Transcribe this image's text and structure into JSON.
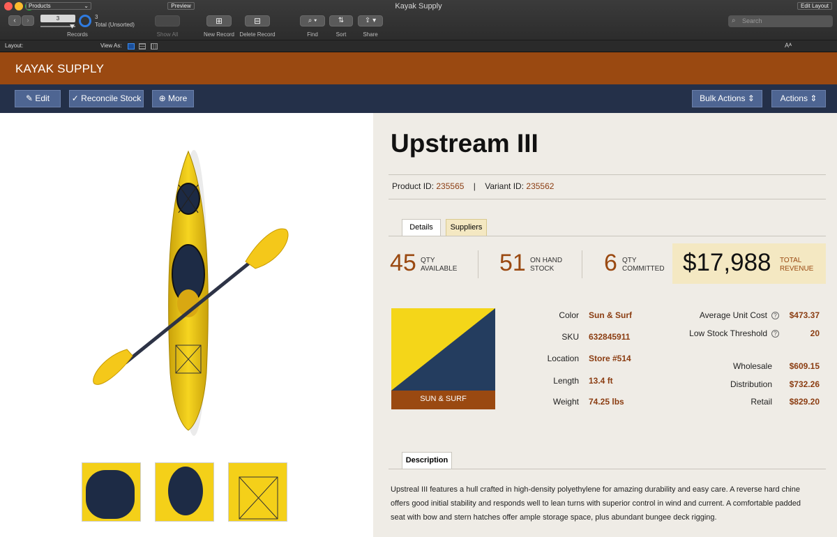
{
  "window": {
    "title": "Kayak Supply"
  },
  "toolbar": {
    "record_current": "3",
    "records_label": "Records",
    "total_count": "3",
    "total_status": "Total (Unsorted)",
    "show_all": "Show All",
    "new_record": "New Record",
    "delete_record": "Delete Record",
    "find": "Find",
    "sort": "Sort",
    "share": "Share",
    "search_placeholder": "Search"
  },
  "layout_bar": {
    "layout_label": "Layout:",
    "layout_value": "Products",
    "view_as": "View As:",
    "preview": "Preview",
    "edit_layout": "Edit Layout"
  },
  "banner": {
    "brand": "KAYAK SUPPLY"
  },
  "nav": {
    "edit": "Edit",
    "reconcile": "Reconcile Stock",
    "more": "More",
    "bulk_actions": "Bulk Actions",
    "actions": "Actions"
  },
  "product": {
    "name": "Upstream III",
    "product_id_label": "Product ID:",
    "product_id": "235565",
    "variant_id_label": "Variant ID:",
    "variant_id": "235562",
    "tabs": [
      "Details",
      "Suppliers"
    ],
    "stats": {
      "qty_available": "45",
      "qty_available_label1": "QTY",
      "qty_available_label2": "AVAILABLE",
      "on_hand": "51",
      "on_hand_label1": "ON HAND",
      "on_hand_label2": "STOCK",
      "committed": "6",
      "committed_label1": "QTY",
      "committed_label2": "COMMITTED",
      "revenue": "$17,988",
      "revenue_label1": "TOTAL",
      "revenue_label2": "REVENUE"
    },
    "swatch_label": "SUN & SURF",
    "colors": {
      "swatch_yellow": "#f4d619",
      "swatch_navy": "#243d5f",
      "swatch_brown": "#9a4911"
    },
    "attributes": [
      {
        "label": "Color",
        "value": "Sun & Surf"
      },
      {
        "label": "SKU",
        "value": "632845911"
      },
      {
        "label": "Location",
        "value": "Store #514"
      },
      {
        "label": "Length",
        "value": "13.4 ft"
      },
      {
        "label": "Weight",
        "value": "74.25 lbs"
      }
    ],
    "pricing": [
      {
        "label": "Average Unit Cost",
        "value": "$473.37"
      },
      {
        "label": "Low Stock Threshold",
        "value": "20"
      },
      {
        "label": "Wholesale",
        "value": "$609.15"
      },
      {
        "label": "Distribution",
        "value": "$732.26"
      },
      {
        "label": "Retail",
        "value": "$829.20"
      }
    ],
    "description_tab": "Description",
    "description": "Upstreal III features a hull crafted in high-density polyethylene for amazing durability and easy care. A reverse hard chine offers good initial stability and responds well to lean turns with superior control in wind and current. A comfortable padded seat with bow and stern hatches offer ample storage space, plus abundant bungee deck rigging."
  }
}
